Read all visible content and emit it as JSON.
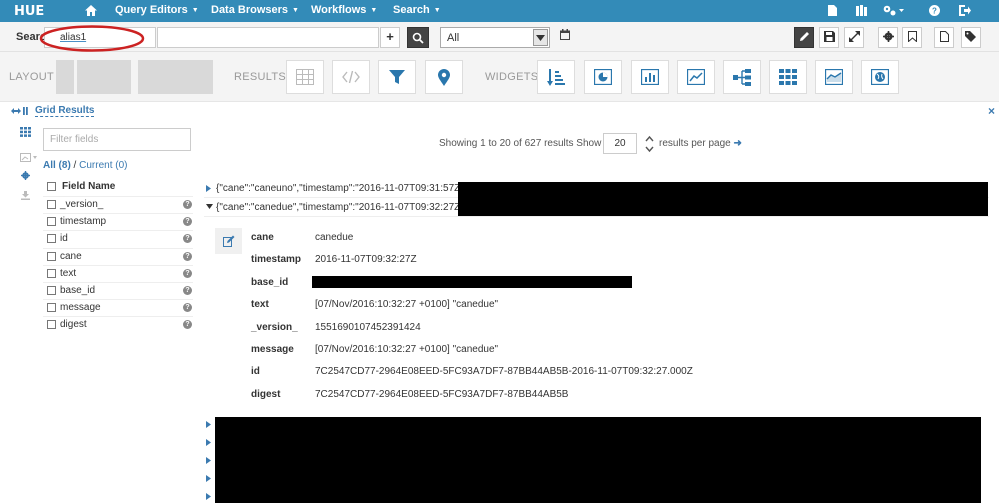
{
  "app": {
    "logo": "HUE"
  },
  "nav": {
    "items": [
      "Query Editors",
      "Data Browsers",
      "Workflows",
      "Search"
    ]
  },
  "search": {
    "label": "Search",
    "collection_alias": "alias1",
    "query_placeholder": "",
    "select_value": "All"
  },
  "widgetbar": {
    "layout_label": "LAYOUT",
    "results_label": "RESULTS",
    "widgets_label": "WIDGETS"
  },
  "grid": {
    "title": "Grid Results"
  },
  "sidebar": {
    "filter_placeholder": "Filter fields",
    "tab_all": "All (8)",
    "tab_sep": " / ",
    "tab_current": "Current (0)",
    "field_header": "Field Name",
    "fields": [
      "_version_",
      "timestamp",
      "id",
      "cane",
      "text",
      "base_id",
      "message",
      "digest"
    ],
    "help_glyph": "?"
  },
  "results": {
    "showing_text": "Showing 1 to 20 of 627 results Show",
    "page_size": "20",
    "per_page_text": "results per page",
    "rows": [
      "{\"cane\":\"caneuno\",\"timestamp\":\"2016-11-07T09:31:57Z\"",
      "{\"cane\":\"canedue\",\"timestamp\":\"2016-11-07T09:32:27Z\""
    ],
    "detail": [
      {
        "key": "cane",
        "value": "canedue"
      },
      {
        "key": "timestamp",
        "value": "2016-11-07T09:32:27Z"
      },
      {
        "key": "base_id",
        "value": ""
      },
      {
        "key": "text",
        "value": "[07/Nov/2016:10:32:27 +0100] \"canedue\""
      },
      {
        "key": "_version_",
        "value": "1551690107452391424"
      },
      {
        "key": "message",
        "value": "[07/Nov/2016:10:32:27 +0100] \"canedue\""
      },
      {
        "key": "id",
        "value": "7C2547CD77-2964E08EED-5FC93A7DF7-87BB44AB5B-2016-11-07T09:32:27.000Z"
      },
      {
        "key": "digest",
        "value": "7C2547CD77-2964E08EED-5FC93A7DF7-87BB44AB5B"
      }
    ]
  },
  "colors": {
    "nav_bg": "#338bb8",
    "link": "#3b7ab0",
    "annotation_circle": "#cc2222"
  }
}
